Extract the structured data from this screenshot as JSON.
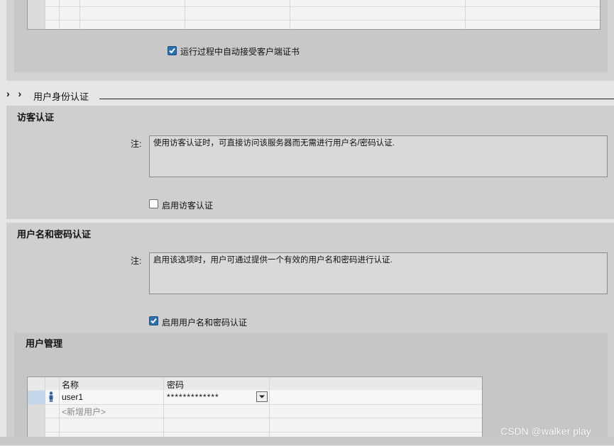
{
  "top_section": {
    "auto_accept_label": "运行过程中自动接受客户端证书",
    "auto_accept_checked": true
  },
  "auth_section": {
    "chevrons": "› ›",
    "title": "用户身份认证"
  },
  "guest_auth": {
    "title": "访客认证",
    "note_label": "注:",
    "note_text": "使用访客认证时，可直接访问该服务器而无需进行用户名/密码认证.",
    "enable_label": "启用访客认证",
    "enable_checked": false
  },
  "user_auth": {
    "title": "用户名和密码认证",
    "note_label": "注:",
    "note_text": "启用该选项时，用户可通过提供一个有效的用户名和密码进行认证.",
    "enable_label": "启用用户名和密码认证",
    "enable_checked": true
  },
  "user_management": {
    "title": "用户管理",
    "columns": [
      "名称",
      "密码"
    ],
    "rows": [
      {
        "name": "user1",
        "password": "*************"
      }
    ],
    "add_placeholder": "<新增用户>"
  },
  "watermark": "CSDN @walker play"
}
